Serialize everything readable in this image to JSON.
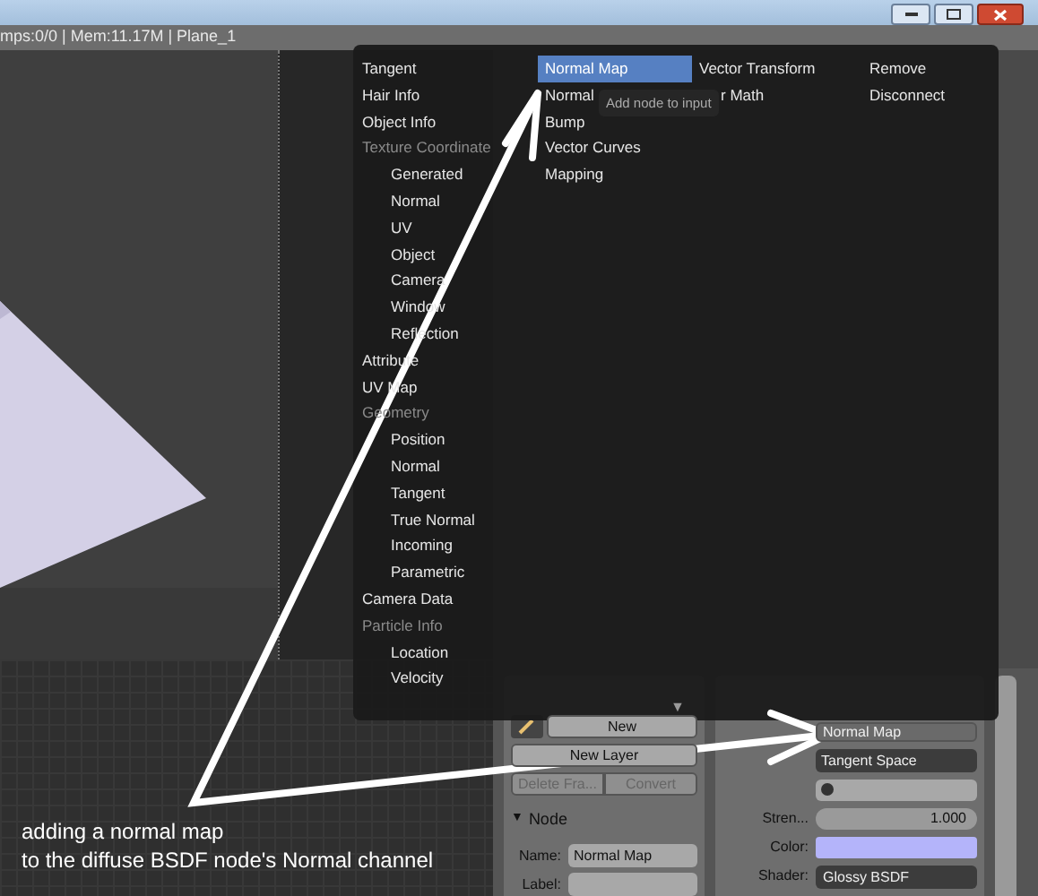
{
  "window": {
    "status": "mps:0/0 | Mem:11.17M | Plane_1"
  },
  "menu": {
    "columns": [
      [
        {
          "label": "Tangent",
          "kind": "item",
          "selected": false
        },
        {
          "label": "Hair Info",
          "kind": "item",
          "selected": false
        },
        {
          "label": "Object Info",
          "kind": "item",
          "selected": false
        },
        {
          "label": "Texture Coordinate",
          "kind": "heading",
          "selected": false
        },
        {
          "label": "Generated",
          "kind": "subitem",
          "selected": false
        },
        {
          "label": "Normal",
          "kind": "subitem",
          "selected": false
        },
        {
          "label": "UV",
          "kind": "subitem",
          "selected": false
        },
        {
          "label": "Object",
          "kind": "subitem",
          "selected": false
        },
        {
          "label": "Camera",
          "kind": "subitem",
          "selected": false
        },
        {
          "label": "Window",
          "kind": "subitem",
          "selected": false
        },
        {
          "label": "Reflection",
          "kind": "subitem",
          "selected": false
        },
        {
          "label": "Attribute",
          "kind": "item",
          "selected": false
        },
        {
          "label": "UV Map",
          "kind": "item",
          "selected": false
        },
        {
          "label": "Geometry",
          "kind": "heading",
          "selected": false
        },
        {
          "label": "Position",
          "kind": "subitem",
          "selected": false
        },
        {
          "label": "Normal",
          "kind": "subitem",
          "selected": false
        },
        {
          "label": "Tangent",
          "kind": "subitem",
          "selected": false
        },
        {
          "label": "True Normal",
          "kind": "subitem",
          "selected": false
        },
        {
          "label": "Incoming",
          "kind": "subitem",
          "selected": false
        },
        {
          "label": "Parametric",
          "kind": "subitem",
          "selected": false
        },
        {
          "label": "Camera Data",
          "kind": "item",
          "selected": false
        },
        {
          "label": "Particle Info",
          "kind": "heading",
          "selected": false
        },
        {
          "label": "Location",
          "kind": "subitem",
          "selected": false
        },
        {
          "label": "Velocity",
          "kind": "subitem",
          "selected": false
        }
      ],
      [
        {
          "label": "Normal Map",
          "kind": "item",
          "selected": true
        },
        {
          "label": "Normal",
          "kind": "item",
          "selected": false
        },
        {
          "label": "Bump",
          "kind": "item",
          "selected": false
        },
        {
          "label": "Vector Curves",
          "kind": "item",
          "selected": false
        },
        {
          "label": "Mapping",
          "kind": "item",
          "selected": false
        }
      ],
      [
        {
          "label": "Vector Transform",
          "kind": "item",
          "selected": false
        },
        {
          "label": "r Math",
          "kind": "fragment",
          "selected": false
        }
      ],
      [
        {
          "label": "Remove",
          "kind": "item",
          "selected": false
        },
        {
          "label": "Disconnect",
          "kind": "item",
          "selected": false
        }
      ]
    ],
    "scroll_arrow": "▼"
  },
  "tooltip": "Add node to input",
  "grease_pencil": {
    "new_button": "New",
    "new_layer_button": "New Layer",
    "delete_button": {
      "label": "Delete Fra...",
      "disabled": true
    },
    "convert_button": {
      "label": "Convert",
      "disabled": true
    }
  },
  "node_panel": {
    "toggle": "▼",
    "heading": "Node",
    "name_label": "Name:",
    "name_value": "Normal Map",
    "label_label": "Label:"
  },
  "inputs": {
    "normal_value": "Normal Map",
    "space": "Tangent Space",
    "strength_label": "Stren...",
    "strength_value": "1.000",
    "color_label": "Color:",
    "shader_label": "Shader:",
    "shader_value": "Glossy BSDF"
  },
  "caption": [
    "adding a normal map",
    "to the diffuse BSDF node's Normal channel"
  ]
}
